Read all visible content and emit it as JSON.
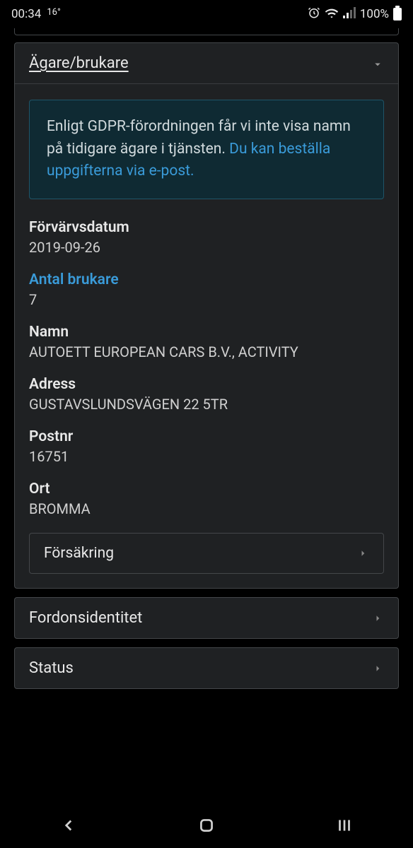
{
  "statusBar": {
    "time": "00:34",
    "temp": "16°",
    "battery": "100%"
  },
  "sections": {
    "owner": {
      "title": "Ägare/brukare",
      "gdprText": "Enligt GDPR-förordningen får vi inte visa namn på tidigare ägare i tjänsten. ",
      "gdprLink": "Du kan beställa uppgifterna via e-post.",
      "fields": {
        "acquisitionLabel": "Förvärvsdatum",
        "acquisitionValue": "2019-09-26",
        "usersLabel": "Antal brukare",
        "usersValue": "7",
        "nameLabel": "Namn",
        "nameValue": "AUTOETT EUROPEAN CARS B.V., ACTIVITY",
        "addressLabel": "Adress",
        "addressValue": "GUSTAVSLUNDSVÄGEN 22 5TR",
        "postcodeLabel": "Postnr",
        "postcodeValue": "16751",
        "cityLabel": "Ort",
        "cityValue": "BROMMA"
      },
      "insuranceButton": "Försäkring"
    },
    "identity": {
      "title": "Fordonsidentitet"
    },
    "status": {
      "title": "Status"
    }
  }
}
